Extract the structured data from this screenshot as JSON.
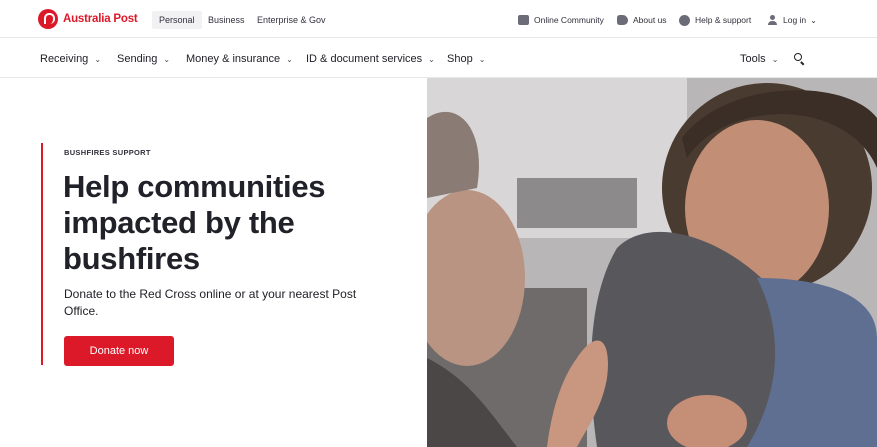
{
  "brand": {
    "name": "Australia Post",
    "color": "#dc1928"
  },
  "segments": [
    {
      "label": "Personal",
      "active": true
    },
    {
      "label": "Business",
      "active": false
    },
    {
      "label": "Enterprise & Gov",
      "active": false
    }
  ],
  "utility_nav": {
    "community": {
      "label": "Online Community",
      "icon": "chat-icon"
    },
    "about": {
      "label": "About us",
      "icon": "australia-icon"
    },
    "help": {
      "label": "Help & support",
      "icon": "help-icon"
    },
    "login": {
      "label": "Log in",
      "icon": "user-icon"
    }
  },
  "main_nav": {
    "items": [
      {
        "label": "Receiving"
      },
      {
        "label": "Sending"
      },
      {
        "label": "Money & insurance"
      },
      {
        "label": "ID & document services"
      },
      {
        "label": "Shop"
      }
    ],
    "tools": "Tools"
  },
  "hero": {
    "eyebrow": "BUSHFIRES SUPPORT",
    "headline": "Help communities impacted by the bushfires",
    "subtext": "Donate to the Red Cross online or at your nearest Post Office.",
    "cta": "Donate now"
  }
}
